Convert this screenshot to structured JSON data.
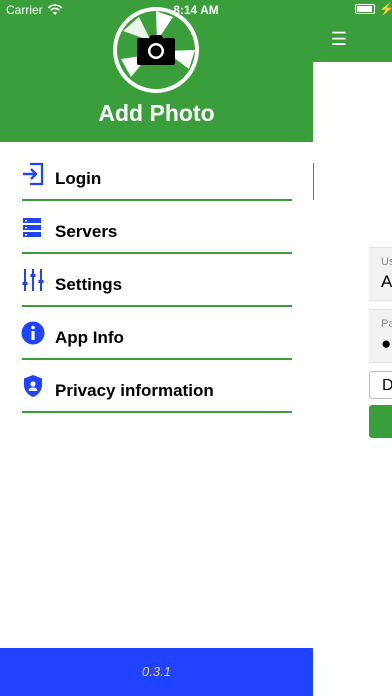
{
  "status_bar": {
    "carrier": "Carrier",
    "time": "8:14 AM"
  },
  "background_screen": {
    "menu_icon": "☰",
    "fields": [
      {
        "label": "Us",
        "value": "A"
      },
      {
        "label": "Pa",
        "value": "●"
      }
    ],
    "select_value": "D"
  },
  "drawer": {
    "title": "Add Photo",
    "items": [
      {
        "label": "Login",
        "icon": "login-icon"
      },
      {
        "label": "Servers",
        "icon": "servers-icon"
      },
      {
        "label": "Settings",
        "icon": "settings-sliders-icon"
      },
      {
        "label": "App Info",
        "icon": "info-icon"
      },
      {
        "label": "Privacy information",
        "icon": "privacy-shield-icon"
      }
    ],
    "version": "0.3.1"
  },
  "colors": {
    "primary_green": "#3a9f3a",
    "footer_blue": "#1f43ff",
    "version_yellow": "#f6d637",
    "icon_blue": "#1f43ff"
  }
}
